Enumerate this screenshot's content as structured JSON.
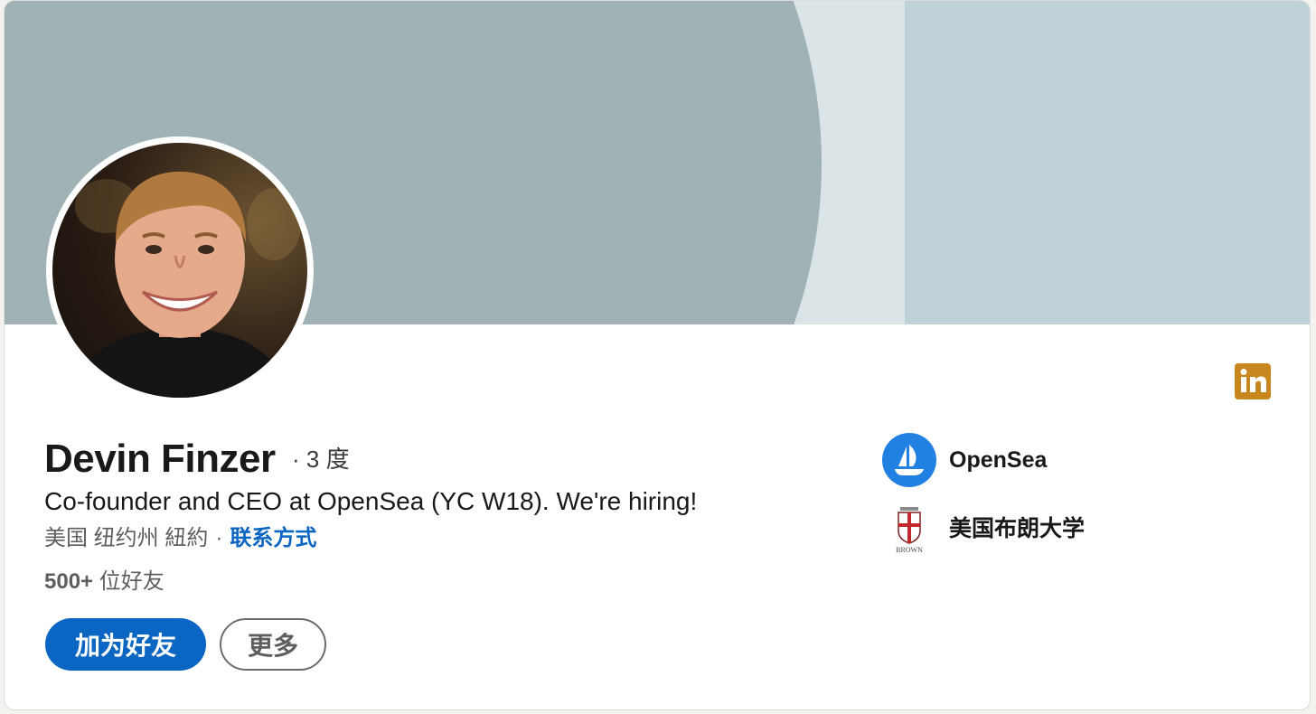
{
  "profile": {
    "name": "Devin Finzer",
    "degree": "· 3 度",
    "headline": "Co-founder and CEO at OpenSea (YC W18). We're hiring!",
    "location": "美国 纽约州 紐約",
    "location_separator": "·",
    "contact_link": "联系方式",
    "connections_count": "500+",
    "connections_suffix": " 位好友"
  },
  "actions": {
    "connect_label": "加为好友",
    "more_label": "更多"
  },
  "organizations": [
    {
      "name": "OpenSea",
      "icon": "opensea-logo"
    },
    {
      "name": "美国布朗大学",
      "icon": "brown-university-crest",
      "logo_text": "BROWN"
    }
  ],
  "icons": {
    "linkedin": "linkedin-icon"
  },
  "colors": {
    "primary": "#0a66c2",
    "linkedin_badge": "#c8871e",
    "opensea": "#2081e2",
    "banner_arc": "#a0b2b6",
    "banner_bg": "#dbe5e8",
    "banner_panel": "#bed2d7"
  }
}
